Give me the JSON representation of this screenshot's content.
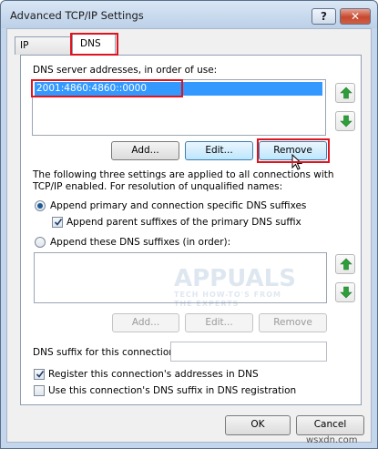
{
  "window": {
    "title": "Advanced TCP/IP Settings",
    "help_glyph": "?",
    "close_glyph": "✕"
  },
  "tabs": [
    {
      "label": "IP Settings"
    },
    {
      "label": "DNS"
    }
  ],
  "dns": {
    "servers_label": "DNS server addresses, in order of use:",
    "servers": [
      "2001:4860:4860::0000"
    ],
    "add_label": "Add...",
    "edit_label": "Edit...",
    "remove_label": "Remove",
    "description": "The following three settings are applied to all connections with TCP/IP enabled. For resolution of unqualified names:",
    "append_primary_label": "Append primary and connection specific DNS suffixes",
    "append_parent_label": "Append parent suffixes of the primary DNS suffix",
    "append_these_label": "Append these DNS suffixes (in order):",
    "suffix_add_label": "Add...",
    "suffix_edit_label": "Edit...",
    "suffix_remove_label": "Remove",
    "connection_suffix_label": "DNS suffix for this connection:",
    "connection_suffix_value": "",
    "register_label": "Register this connection's addresses in DNS",
    "use_suffix_label": "Use this connection's DNS suffix in DNS registration",
    "state": {
      "append_primary_selected": true,
      "append_parent_checked": true,
      "append_these_selected": false,
      "register_checked": true,
      "use_suffix_checked": false
    }
  },
  "footer": {
    "ok_label": "OK",
    "cancel_label": "Cancel"
  },
  "watermark": {
    "logo_text": "APPUALS",
    "tagline": "TECH HOW-TO'S FROM THE EXPERTS",
    "site": "wsxdn.com"
  },
  "colors": {
    "selection": "#3399ff",
    "highlight": "#e0141e",
    "arrow": "#2e9e3a"
  }
}
